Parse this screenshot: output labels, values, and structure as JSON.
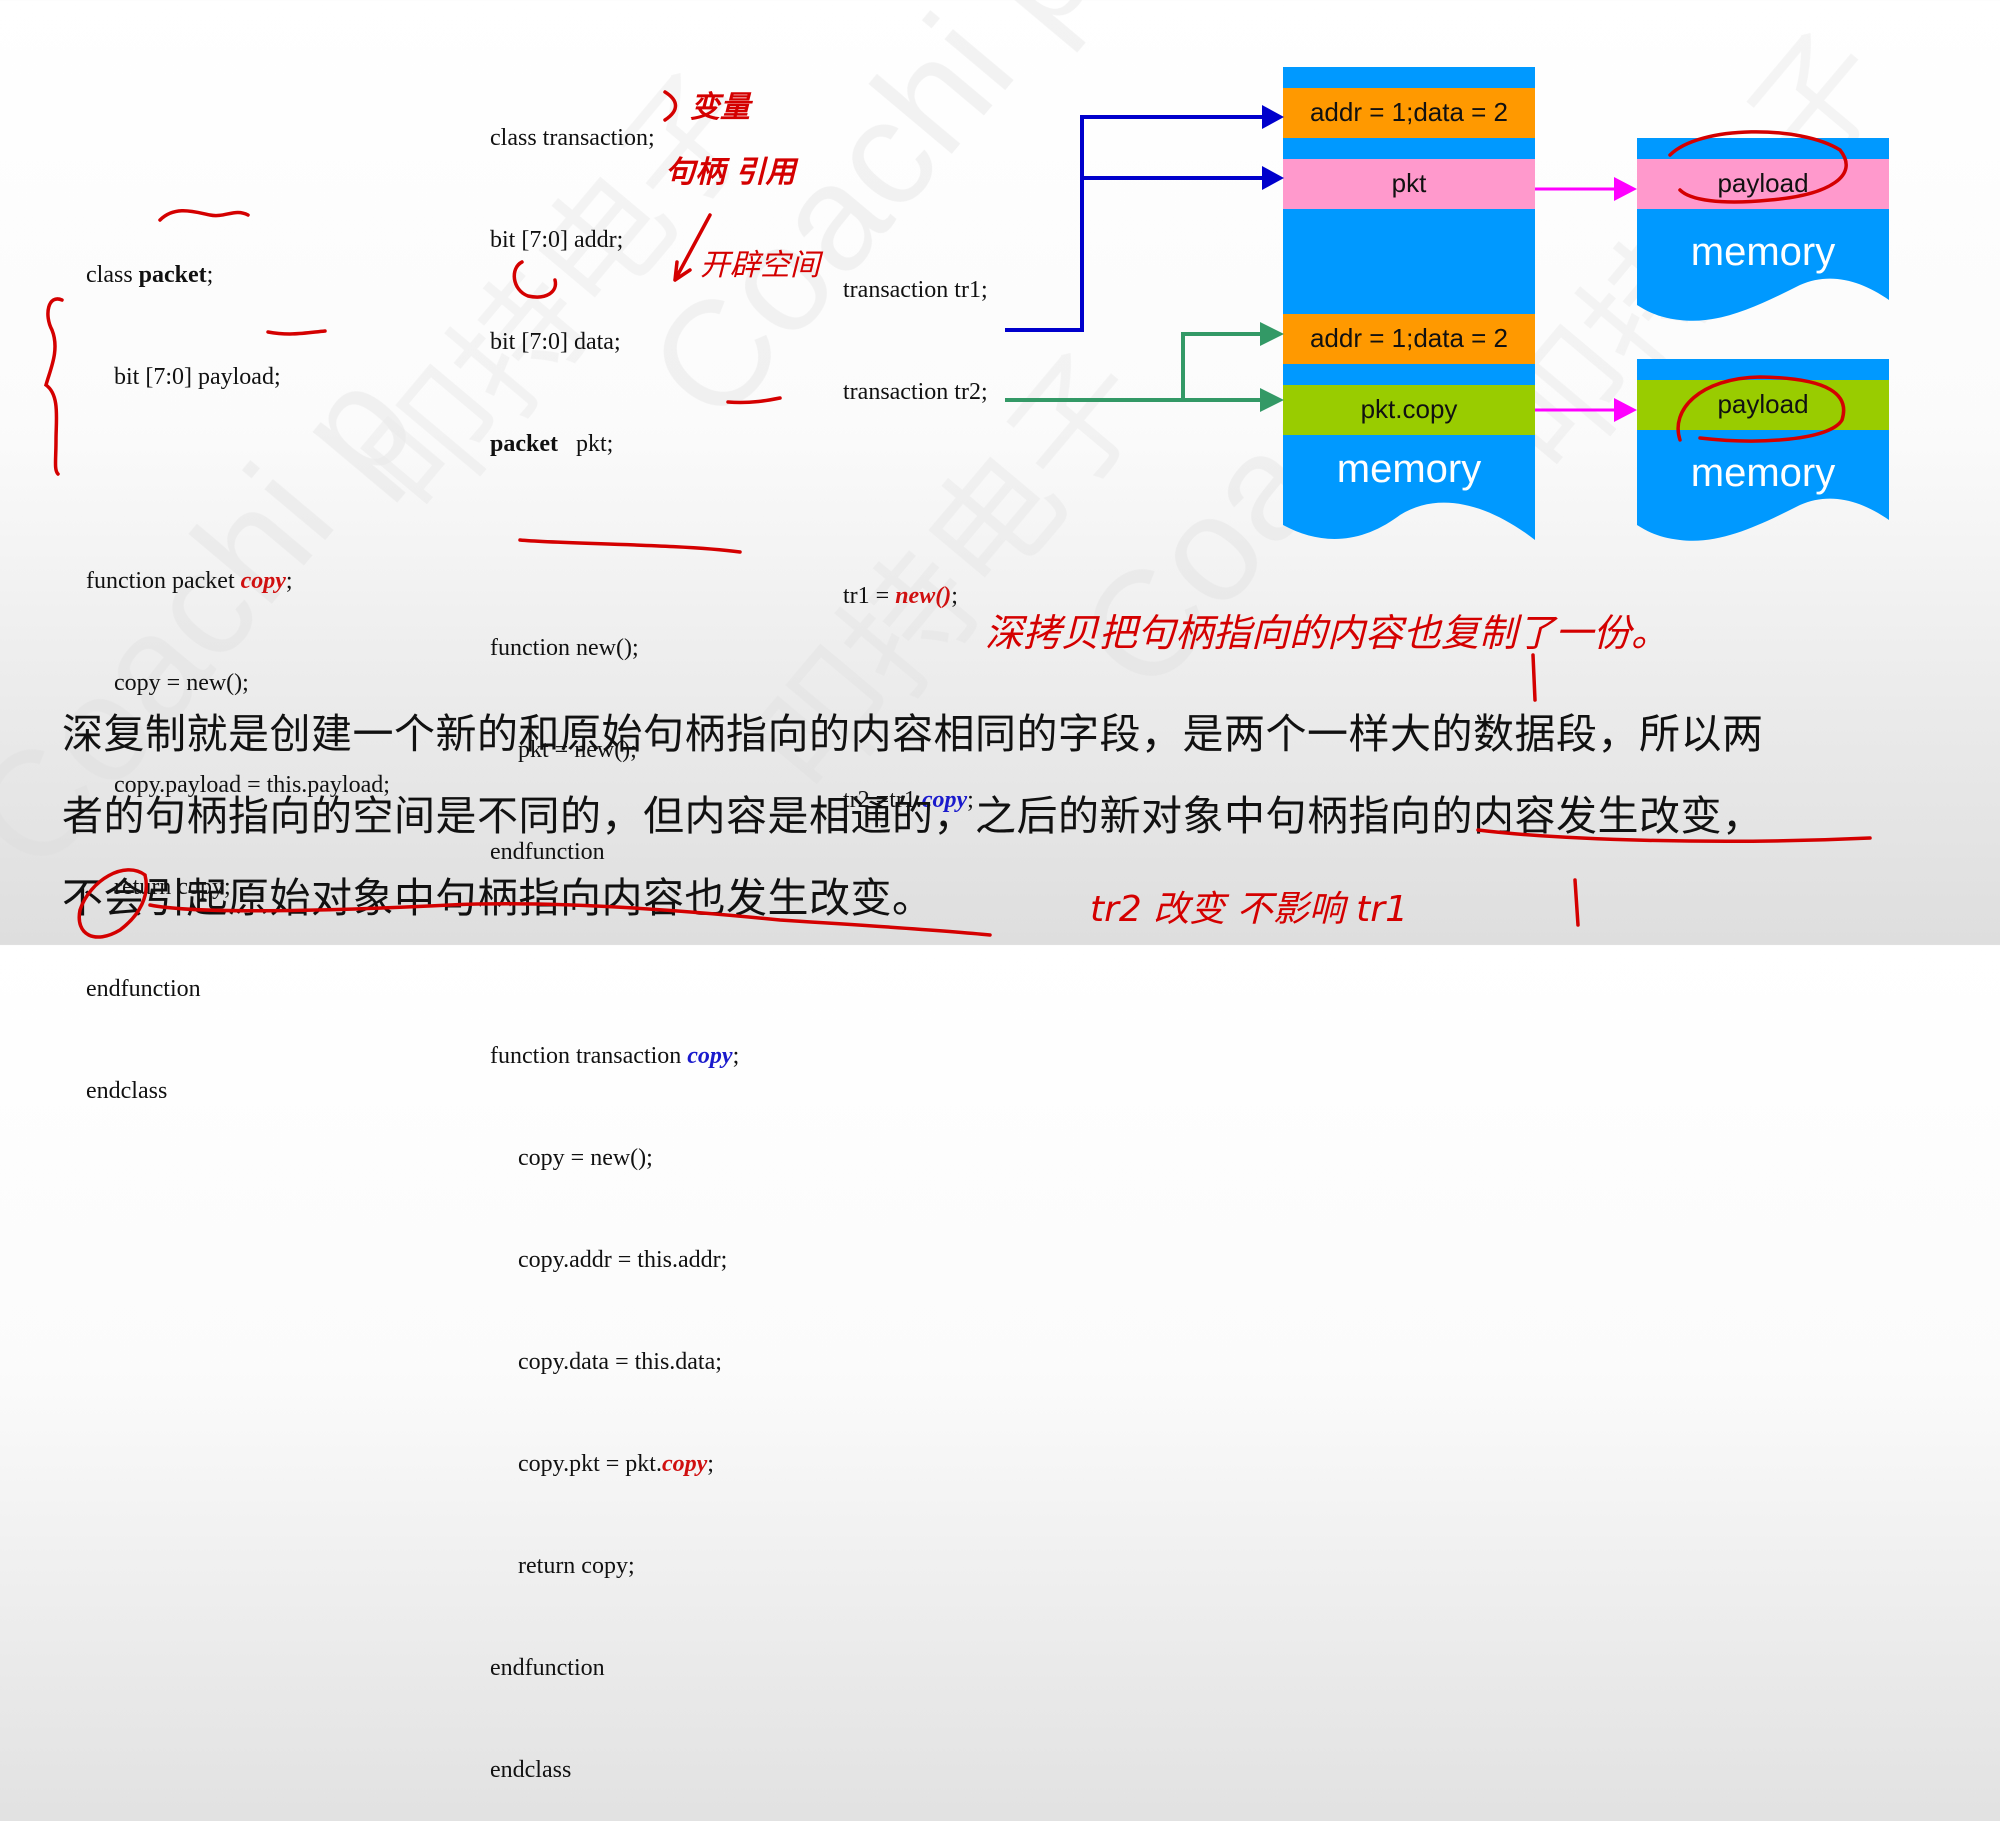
{
  "watermark": {
    "text_latin": "Coachi p",
    "text_cjk": "叩持电子"
  },
  "code_packet": {
    "lines": [
      {
        "t": "class ",
        "b": "packet",
        "s": ";"
      },
      {
        "t": "bit [7:0] payload;"
      },
      {
        "t": ""
      },
      {
        "t": "function packet ",
        "r": "copy",
        "s": ";"
      },
      {
        "t": "copy = new();"
      },
      {
        "t": "copy.payload = this.payload;"
      },
      {
        "t": "return copy;"
      },
      {
        "t": "endfunction"
      },
      {
        "t": "endclass"
      }
    ],
    "line0": "class ",
    "line0_bold": "packet",
    "line0_end": ";",
    "line1": "bit [7:0] payload;",
    "line3": "function packet ",
    "line3_red": "copy",
    "line3_end": ";",
    "line4": "copy = new();",
    "line5": "copy.payload = this.payload;",
    "line6": "return copy;",
    "line7": "endfunction",
    "line8": "endclass"
  },
  "code_transaction": {
    "line0": "class transaction;",
    "line1": "bit [7:0] addr;",
    "line2": "bit [7:0] data;",
    "line3_bold": "packet",
    "line3": "   pkt;",
    "line5": "function new();",
    "line6": "pkt = new();",
    "line7": "endfunction",
    "line9": "function transaction ",
    "line9_blue": "copy",
    "line9_end": ";",
    "line10": "copy = new();",
    "line11": "copy.addr = this.addr;",
    "line12": "copy.data = this.data;",
    "line13": "copy.pkt = pkt.",
    "line13_red": "copy",
    "line13_end": ";",
    "line14": "return copy;",
    "line15": "endfunction",
    "line16": "endclass"
  },
  "code_usage": {
    "line0": "transaction tr1;",
    "line1": "transaction tr2;",
    "line3": "tr1 = ",
    "line3_red": "new()",
    "line3_end": ";",
    "line5": "tr2 =tr1.",
    "line5_blue": "copy",
    "line5_end": ";"
  },
  "diagram": {
    "main_memory": {
      "field_addr_data_1": "addr = 1;data = 2",
      "field_pkt": "pkt",
      "field_addr_data_2": "addr = 1;data = 2",
      "field_pkt_copy": "pkt.copy",
      "label": "memory"
    },
    "payload_memory_1": {
      "field": "payload",
      "label": "memory"
    },
    "payload_memory_2": {
      "field": "payload",
      "label": "memory"
    },
    "colors": {
      "memory_blue": "#0099ff",
      "orange": "#ff9900",
      "pink": "#ff99cc",
      "green": "#99cc00",
      "arrow_blue": "#0000cc",
      "arrow_green": "#339966",
      "arrow_magenta": "#ff00ff",
      "annotation_red": "#d40000"
    }
  },
  "explanation": {
    "line1": "深复制就是创建一个新的和原始句柄指向的内容相同的字段，是两个一样大的数据段，所以两",
    "line2": "者的句柄指向的空间是不同的，但内容是相通的，之后的新对象中句柄指向的内容发生改变，",
    "line3": "不会引起原始对象中句柄指向内容也发生改变。"
  },
  "handwritten_notes": {
    "variables": "变量",
    "handle_ref": "句柄 引用",
    "alloc_space": "开辟空间",
    "deep_copy_note": "深拷贝把句柄指向的内容也复制了一份。",
    "tr2_note": "tr2 改变 不影响 tr1"
  }
}
